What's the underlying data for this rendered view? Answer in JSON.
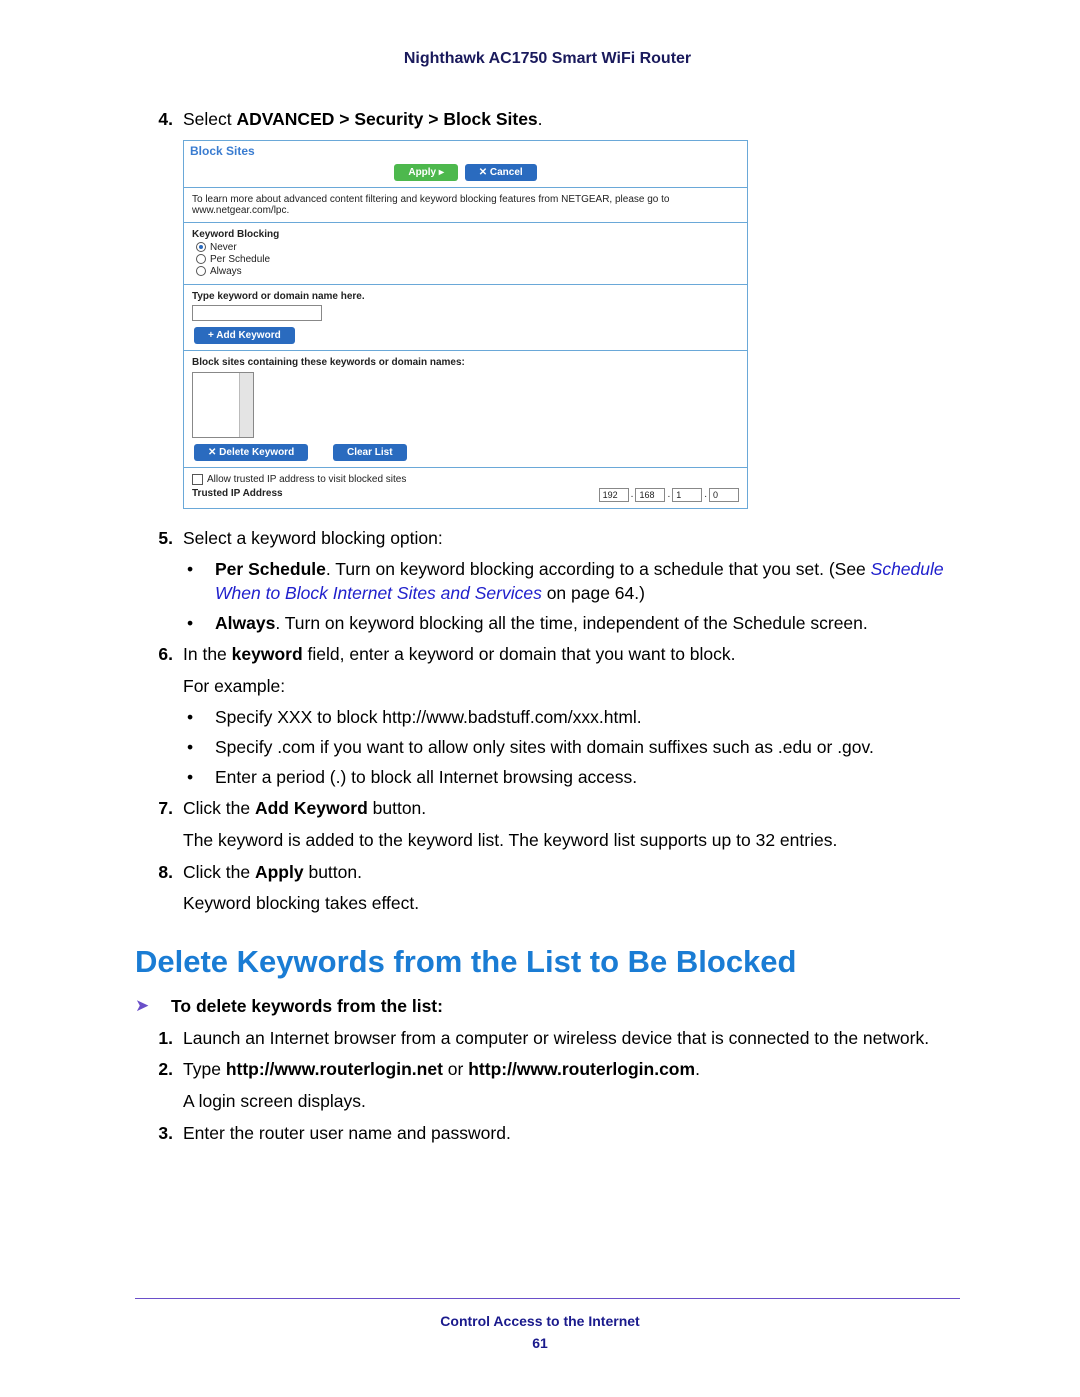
{
  "header": {
    "title": "Nighthawk AC1750 Smart WiFi Router"
  },
  "steps_top": {
    "s4": {
      "num": "4.",
      "pre": "Select ",
      "bold": "ADVANCED > Security > Block Sites",
      "post": "."
    },
    "s5": {
      "num": "5.",
      "text": "Select a keyword blocking option:",
      "bullets": [
        {
          "lead": "Per Schedule",
          "rest1": ". Turn on keyword blocking according to a schedule that you set. (See ",
          "link": "Schedule When to Block Internet Sites and Services",
          "rest2": " on page 64.)"
        },
        {
          "lead": "Always",
          "rest1": ". Turn on keyword blocking all the time, independent of the Schedule screen.",
          "link": "",
          "rest2": ""
        }
      ]
    },
    "s6": {
      "num": "6.",
      "pre": "In the ",
      "bold": "keyword",
      "post": " field, enter a keyword or domain that you want to block.",
      "sub": "For example:",
      "bullets": [
        "Specify XXX to block http://www.badstuff.com/xxx.html.",
        "Specify .com if you want to allow only sites with domain suffixes such as .edu or .gov.",
        "Enter a period (.) to block all Internet browsing access."
      ]
    },
    "s7": {
      "num": "7.",
      "pre": "Click the ",
      "bold": "Add Keyword",
      "post": " button.",
      "sub": "The keyword is added to the keyword list. The keyword list supports up to 32 entries."
    },
    "s8": {
      "num": "8.",
      "pre": "Click the ",
      "bold": "Apply",
      "post": " button.",
      "sub": "Keyword blocking takes effect."
    }
  },
  "embed": {
    "panel_title": "Block Sites",
    "apply": "Apply ▸",
    "cancel": "✕ Cancel",
    "info": "To learn more about advanced content filtering and keyword blocking features from NETGEAR, please go to www.netgear.com/lpc.",
    "kb_label": "Keyword Blocking",
    "opt_never": "Never",
    "opt_sched": "Per Schedule",
    "opt_always": "Always",
    "type_label": "Type keyword or domain name here.",
    "add_kw": "+ Add Keyword",
    "block_list_label": "Block sites containing these keywords or domain names:",
    "del_kw": "✕ Delete Keyword",
    "clear": "Clear List",
    "allow_trusted": "Allow trusted IP address to visit blocked sites",
    "trusted_label": "Trusted IP Address",
    "ip": [
      "192",
      "168",
      "1",
      "0"
    ]
  },
  "section": {
    "heading": "Delete Keywords from the List to Be Blocked",
    "lead": "To delete keywords from the list:",
    "s1": {
      "num": "1.",
      "text": "Launch an Internet browser from a computer or wireless device that is connected to the network."
    },
    "s2": {
      "num": "2.",
      "pre": "Type ",
      "bold": "http://www.routerlogin.net",
      "mid": " or ",
      "bold2": "http://www.routerlogin.com",
      "post": ".",
      "sub": "A login screen displays."
    },
    "s3": {
      "num": "3.",
      "text": "Enter the router user name and password."
    }
  },
  "footer": {
    "text": "Control Access to the Internet",
    "page": "61"
  }
}
